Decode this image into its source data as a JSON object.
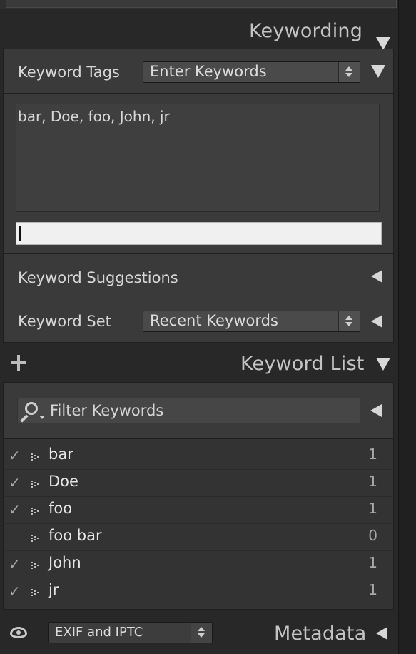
{
  "keywording": {
    "title": "Keywording",
    "keyword_tags_label": "Keyword Tags",
    "keyword_tags_mode": "Enter Keywords",
    "keywords_text": "bar, Doe, foo, John, jr",
    "keyword_input_value": "",
    "suggestions_label": "Keyword Suggestions",
    "keyword_set_label": "Keyword Set",
    "keyword_set_value": "Recent Keywords"
  },
  "keyword_list": {
    "title": "Keyword List",
    "filter_placeholder": "Filter Keywords",
    "items": [
      {
        "name": "bar",
        "count": "1",
        "checked": true,
        "check_glyph": "✓"
      },
      {
        "name": "Doe",
        "count": "1",
        "checked": true,
        "check_glyph": "✓"
      },
      {
        "name": "foo",
        "count": "1",
        "checked": true,
        "check_glyph": "✓"
      },
      {
        "name": "foo bar",
        "count": "0",
        "checked": false,
        "check_glyph": ""
      },
      {
        "name": "John",
        "count": "1",
        "checked": true,
        "check_glyph": "✓"
      },
      {
        "name": "jr",
        "count": "1",
        "checked": true,
        "check_glyph": "✓"
      }
    ]
  },
  "metadata": {
    "title": "Metadata",
    "preset_value": "EXIF and IPTC"
  },
  "icons": {
    "collapse": "triangle-down-icon",
    "expand": "triangle-left-icon",
    "add": "plus-icon",
    "filter": "magnifier-icon",
    "visibility": "eye-icon"
  }
}
